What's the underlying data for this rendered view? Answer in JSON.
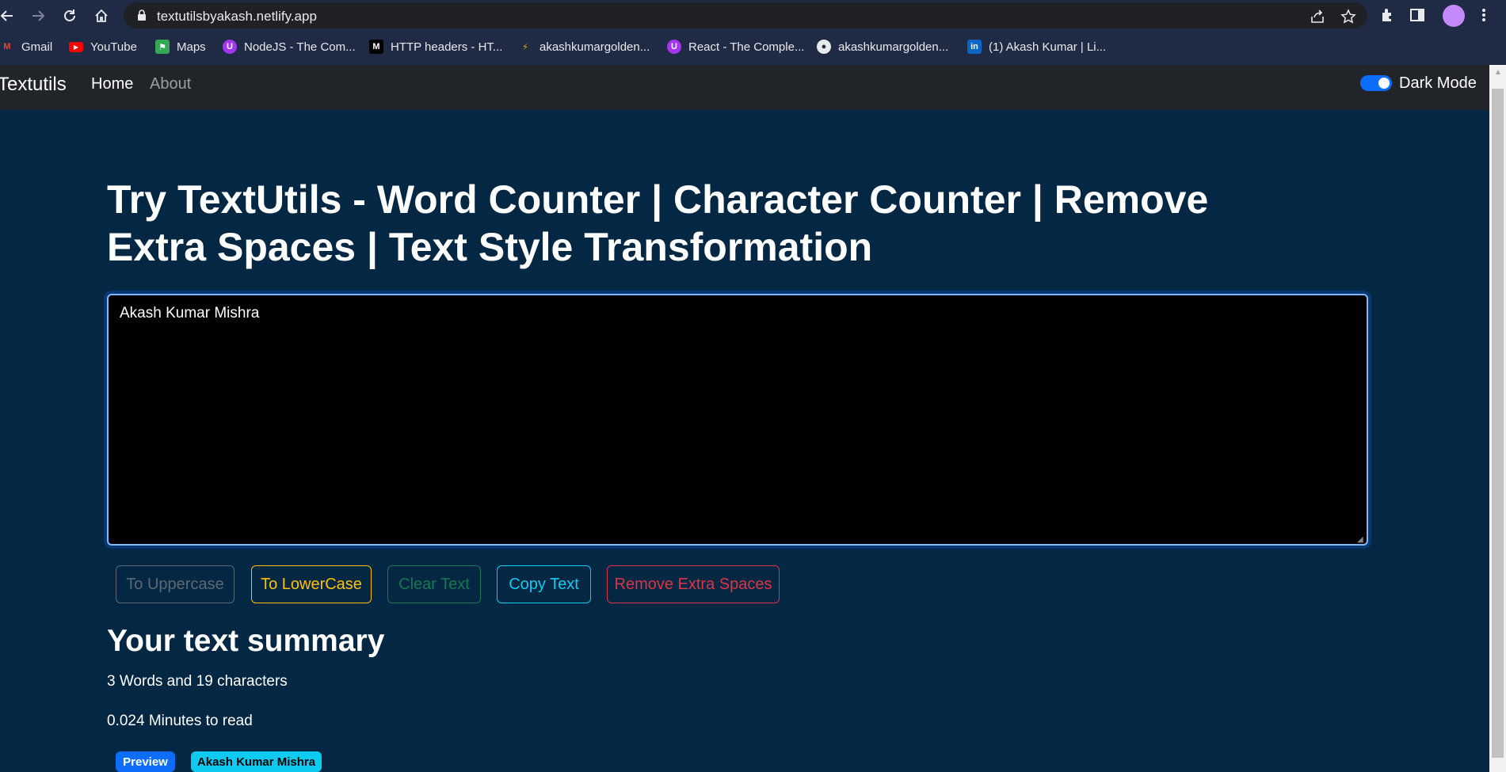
{
  "browser": {
    "url": "textutilsbyakash.netlify.app",
    "bookmarks": [
      {
        "label": "Gmail",
        "icon": "gmail-icon"
      },
      {
        "label": "YouTube",
        "icon": "youtube-icon"
      },
      {
        "label": "Maps",
        "icon": "maps-icon"
      },
      {
        "label": "NodeJS - The Com...",
        "icon": "udemy-icon"
      },
      {
        "label": "HTTP headers - HT...",
        "icon": "mdn-icon"
      },
      {
        "label": "akashkumargolden...",
        "icon": "bookmark-site-icon"
      },
      {
        "label": "React - The Comple...",
        "icon": "udemy-icon"
      },
      {
        "label": "akashkumargolden...",
        "icon": "github-icon"
      },
      {
        "label": "(1) Akash Kumar | Li...",
        "icon": "linkedin-icon"
      }
    ]
  },
  "navbar": {
    "brand": "Textutils",
    "links": [
      "Home",
      "About"
    ],
    "dark_mode_label": "Dark Mode",
    "dark_mode_on": true
  },
  "main": {
    "heading": "Try TextUtils - Word Counter | Character Counter | Remove Extra Spaces | Text Style Transformation",
    "textarea_value": "Akash Kumar Mishra",
    "buttons": [
      "To Uppercase",
      "To LowerCase",
      "Clear Text",
      "Copy Text",
      "Remove Extra Spaces"
    ],
    "summary_title": "Your text summary",
    "summary_counts": "3 Words and 19 characters",
    "read_time": "0.024 Minutes to read",
    "preview_badge": "Preview",
    "preview_text": "Akash Kumar Mishra"
  },
  "colors": {
    "page_bg": "#042743",
    "navbar_bg": "#212529",
    "primary": "#0d6efd",
    "warning": "#ffc107",
    "success": "#198754",
    "info": "#0dcaf0",
    "danger": "#dc3545",
    "secondary": "#6c757d"
  }
}
